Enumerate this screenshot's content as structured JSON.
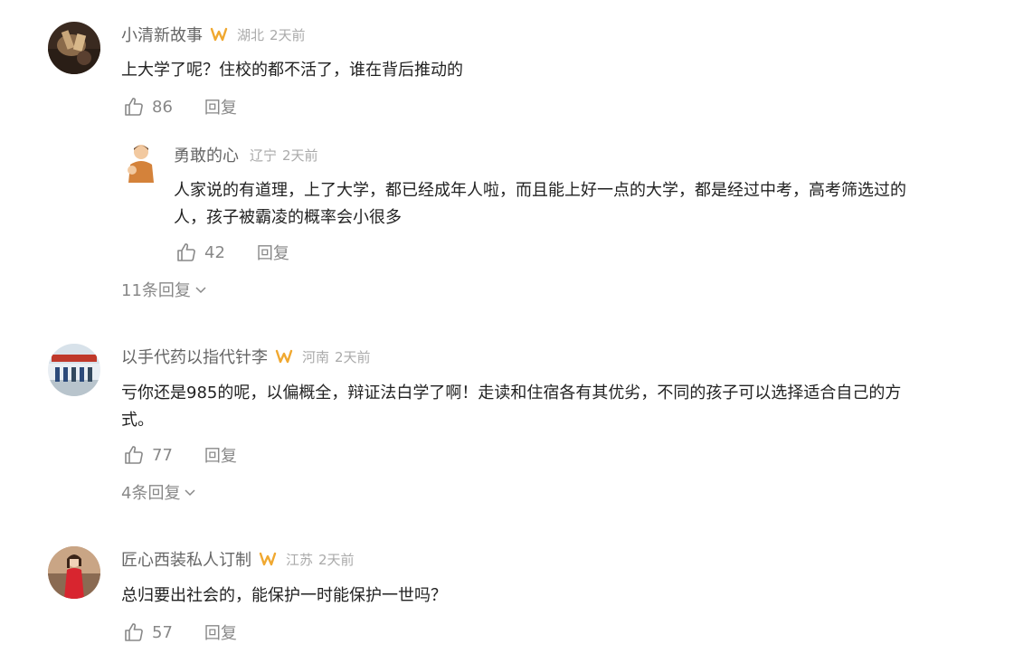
{
  "comments": [
    {
      "username": "小清新故事",
      "location": "湖北",
      "time": "2天前",
      "text_lines": [
        "上大学了呢？住校的都不活了，谁在背后推动的"
      ],
      "likes": "86",
      "reply_label": "回复",
      "reply": {
        "username": "勇敢的心",
        "location": "辽宁",
        "time": "2天前",
        "text_lines": [
          "人家说的有道理，上了大学，都已经成年人啦，而且能上好一点的大学，都是经过中考，高考筛选过的",
          "人，孩子被霸凌的概率会小很多"
        ],
        "likes": "42",
        "reply_label": "回复"
      },
      "more_replies": "11条回复"
    },
    {
      "username": "以手代药以指代针李",
      "location": "河南",
      "time": "2天前",
      "text_lines": [
        "亏你还是985的呢，以偏概全，辩证法白学了啊！走读和住宿各有其优劣，不同的孩子可以选择适合自己的方",
        "式。"
      ],
      "likes": "77",
      "reply_label": "回复",
      "more_replies": "4条回复"
    },
    {
      "username": "匠心西装私人订制",
      "location": "江苏",
      "time": "2天前",
      "text_lines": [
        "总归要出社会的，能保护一时能保护一世吗？"
      ],
      "likes": "57",
      "reply_label": "回复"
    }
  ],
  "icons": {
    "badge": "vip-badge-icon",
    "like": "thumbs-up-icon",
    "expand": "chevron-down-icon"
  },
  "colors": {
    "badge": "#f0a830",
    "text": "#222222",
    "muted": "#888888",
    "meta": "#aaaaaa"
  }
}
